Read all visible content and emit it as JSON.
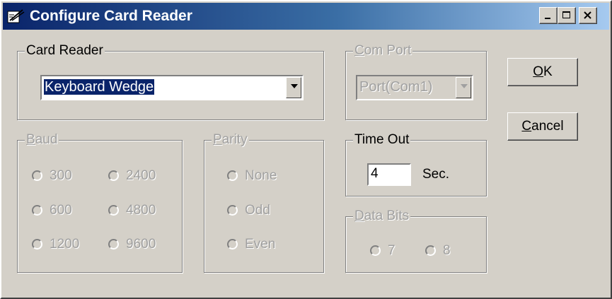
{
  "window": {
    "title": "Configure Card Reader",
    "controls": {
      "minimize": "minimize-icon",
      "maximize": "maximize-icon",
      "close": "close-icon"
    }
  },
  "card_reader": {
    "legend": "Card Reader",
    "selected": "Keyboard Wedge"
  },
  "com_port": {
    "legend_accel": "C",
    "legend_rest": "om Port",
    "selected": "Port(Com1)",
    "enabled": false
  },
  "buttons": {
    "ok_accel": "O",
    "ok_rest": "K",
    "cancel_accel": "C",
    "cancel_rest": "ancel"
  },
  "baud": {
    "legend_accel": "B",
    "legend_rest": "aud",
    "enabled": false,
    "options": [
      "300",
      "2400",
      "600",
      "4800",
      "1200",
      "9600"
    ]
  },
  "parity": {
    "legend_accel": "P",
    "legend_rest": "arity",
    "enabled": false,
    "options": [
      "None",
      "Odd",
      "Even"
    ]
  },
  "time_out": {
    "legend": "Time Out",
    "value": "4",
    "unit": "Sec."
  },
  "data_bits": {
    "legend_accel": "D",
    "legend_rest": "ata Bits",
    "enabled": false,
    "options": [
      "7",
      "8"
    ]
  },
  "colors": {
    "title_gradient_start": "#0a246a",
    "title_gradient_end": "#a6caf0",
    "face": "#d4d0c8",
    "disabled_text": "#a0a0a0",
    "selection": "#0a246a"
  }
}
